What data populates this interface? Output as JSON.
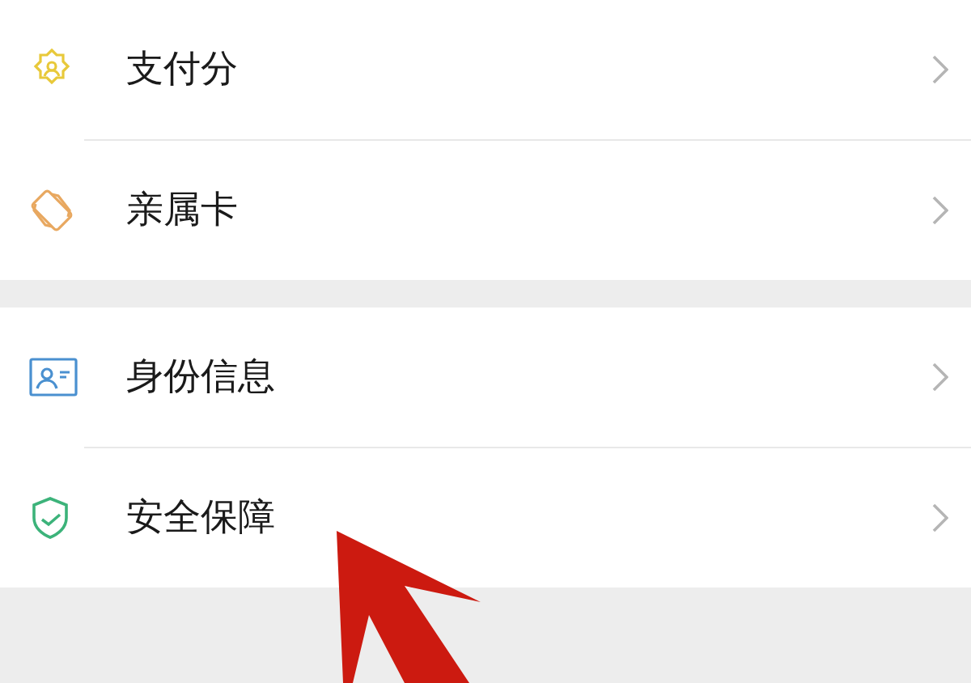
{
  "groups": [
    {
      "items": [
        {
          "label": "支付分"
        },
        {
          "label": "亲属卡"
        }
      ]
    },
    {
      "items": [
        {
          "label": "身份信息"
        },
        {
          "label": "安全保障"
        }
      ]
    }
  ]
}
